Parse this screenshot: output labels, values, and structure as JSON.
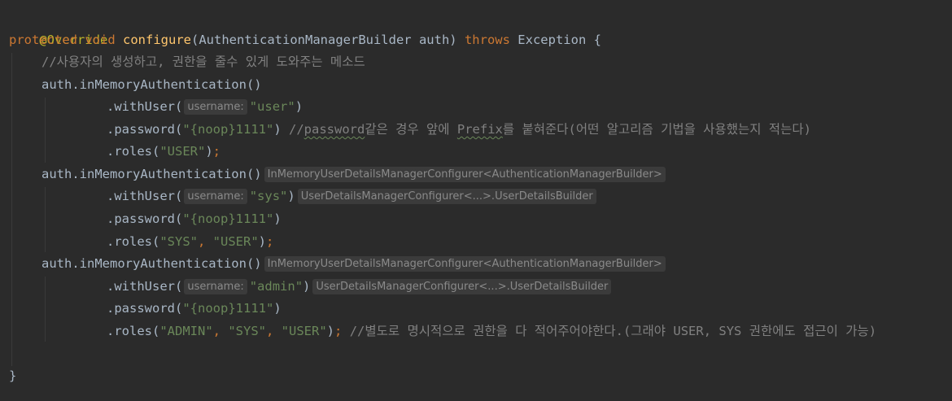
{
  "editor": {
    "colors": {
      "background": "#2b2b2b",
      "annotation": "#bbb529",
      "keyword": "#cc7832",
      "function": "#ffc66d",
      "string": "#6a8759",
      "comment": "#808080",
      "plain": "#a9b7c6",
      "hint_bg": "#3b3b3b",
      "hint_fg": "#8a8a8a"
    },
    "l1": {
      "annotation": "@Override"
    },
    "l2": {
      "kw1": "protected",
      "kw2": "void",
      "fn": "configure",
      "params": "(AuthenticationManagerBuilder auth) ",
      "kw3": "throws",
      "rest": " Exception {"
    },
    "l3": {
      "comment": "//사용자의 생성하고, 권한을 줄수 있게 도와주는 메소드"
    },
    "l4": {
      "code": "auth.inMemoryAuthentication()"
    },
    "l5": {
      "code": ".withUser(",
      "hint": "username:",
      "str": "\"user\"",
      "close": ")"
    },
    "l6": {
      "code": ".password(",
      "str": "\"{noop}1111\"",
      "close": ") ",
      "c1": "//",
      "c2": "password",
      "c3": "같은 경우 앞에 ",
      "c4": "Prefix",
      "c5": "를 붙혀준다(어떤 알고리즘 기법을 사용했는지 적는다)"
    },
    "l7": {
      "code": ".roles(",
      "str": "\"USER\"",
      "close": ")",
      "semi": ";"
    },
    "l8": {
      "code": "auth.inMemoryAuthentication()",
      "hint": "InMemoryUserDetailsManagerConfigurer<AuthenticationManagerBuilder>"
    },
    "l9": {
      "code": ".withUser(",
      "hint": "username:",
      "str": "\"sys\"",
      "close": ")",
      "hint2": "UserDetailsManagerConfigurer<...>.UserDetailsBuilder"
    },
    "l10": {
      "code": ".password(",
      "str": "\"{noop}1111\"",
      "close": ")"
    },
    "l11": {
      "code": ".roles(",
      "str1": "\"SYS\"",
      "sep": ", ",
      "str2": "\"USER\"",
      "close": ")",
      "semi": ";"
    },
    "l12": {
      "code": "auth.inMemoryAuthentication()",
      "hint": "InMemoryUserDetailsManagerConfigurer<AuthenticationManagerBuilder>"
    },
    "l13": {
      "code": ".withUser(",
      "hint": "username:",
      "str": "\"admin\"",
      "close": ")",
      "hint2": "UserDetailsManagerConfigurer<...>.UserDetailsBuilder"
    },
    "l14": {
      "code": ".password(",
      "str": "\"{noop}1111\"",
      "close": ")"
    },
    "l15": {
      "code": ".roles(",
      "str1": "\"ADMIN\"",
      "sep1": ", ",
      "str2": "\"SYS\"",
      "sep2": ", ",
      "str3": "\"USER\"",
      "close": ")",
      "semi": ";",
      "comment": " //별도로 명시적으로 권한을 다 적어주어야한다.(그래야 USER, SYS 권한에도 접근이 가능)"
    },
    "l17": {
      "code": "}"
    }
  }
}
